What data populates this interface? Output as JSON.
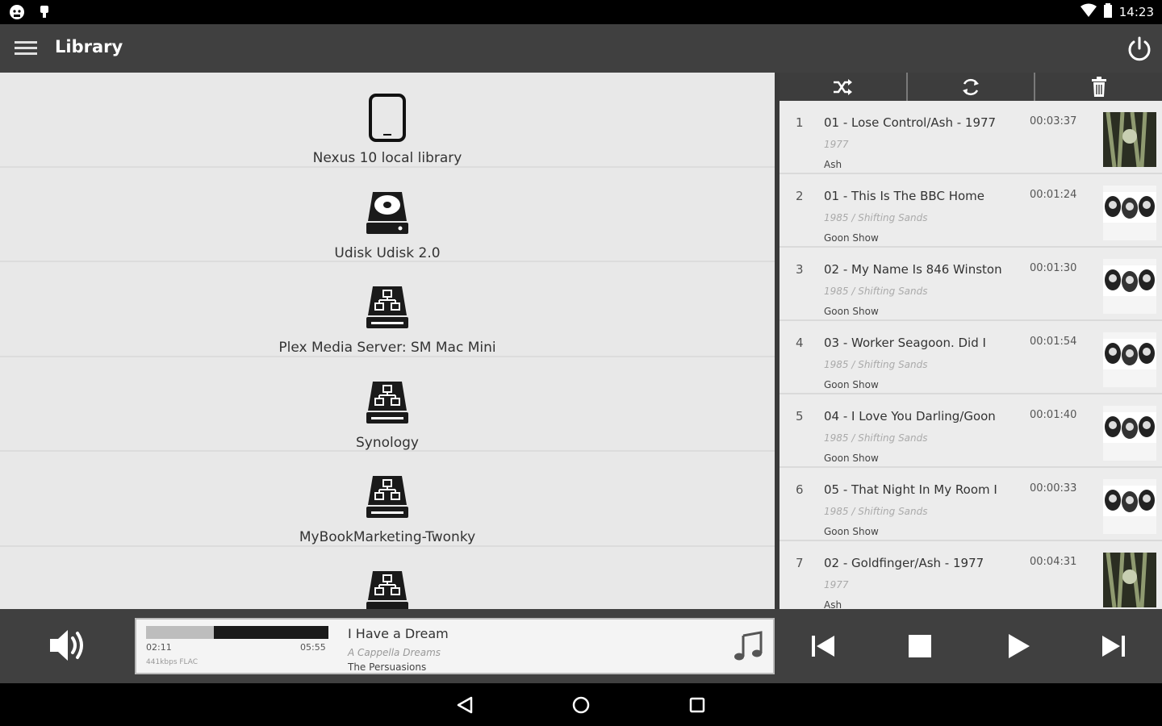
{
  "status_bar": {
    "time": "14:23",
    "icons": [
      "android-debug-icon",
      "notification-icon",
      "wifi-icon",
      "battery-icon"
    ]
  },
  "app_bar": {
    "title": "Library",
    "menu_icon": "hamburger-icon",
    "power_icon": "power-icon"
  },
  "library": {
    "items": [
      {
        "label": "Nexus 10 local library",
        "icon": "tablet-icon"
      },
      {
        "label": "Udisk Udisk 2.0",
        "icon": "disk-drive-icon"
      },
      {
        "label": "Plex Media Server: SM Mac Mini",
        "icon": "network-server-icon"
      },
      {
        "label": "Synology",
        "icon": "network-server-icon"
      },
      {
        "label": "MyBookMarketing-Twonky",
        "icon": "network-server-icon"
      },
      {
        "label": "",
        "icon": "network-server-icon"
      }
    ]
  },
  "queue": {
    "toolbar": [
      "shuffle-icon",
      "repeat-icon",
      "trash-icon"
    ],
    "tracks": [
      {
        "num": "1",
        "title": "01 - Lose Control/Ash - 1977",
        "duration": "00:03:37",
        "sub": "1977",
        "artist": "Ash"
      },
      {
        "num": "2",
        "title": "01 - This Is The BBC Home",
        "duration": "00:01:24",
        "sub": "1985 / Shifting Sands",
        "artist": "Goon Show"
      },
      {
        "num": "3",
        "title": "02 - My Name Is 846 Winston",
        "duration": "00:01:30",
        "sub": "1985 / Shifting Sands",
        "artist": "Goon Show"
      },
      {
        "num": "4",
        "title": "03 - Worker Seagoon. Did I",
        "duration": "00:01:54",
        "sub": "1985 / Shifting Sands",
        "artist": "Goon Show"
      },
      {
        "num": "5",
        "title": "04 - I Love You Darling/Goon",
        "duration": "00:01:40",
        "sub": "1985 / Shifting Sands",
        "artist": "Goon Show"
      },
      {
        "num": "6",
        "title": "05 - That Night In My Room I",
        "duration": "00:00:33",
        "sub": "1985 / Shifting Sands",
        "artist": "Goon Show"
      },
      {
        "num": "7",
        "title": "02 - Goldfinger/Ash - 1977",
        "duration": "00:04:31",
        "sub": "1977",
        "artist": "Ash"
      }
    ]
  },
  "now_playing": {
    "elapsed": "02:11",
    "total": "05:55",
    "progress_fraction": 0.37,
    "format": "441kbps FLAC",
    "title": "I Have a Dream",
    "album": "A Cappella Dreams",
    "artist": "The Persuasions"
  },
  "controls": [
    "volume-icon",
    "previous-icon",
    "stop-icon",
    "play-icon",
    "next-icon"
  ],
  "nav": [
    "back-icon",
    "home-icon",
    "recents-icon"
  ]
}
